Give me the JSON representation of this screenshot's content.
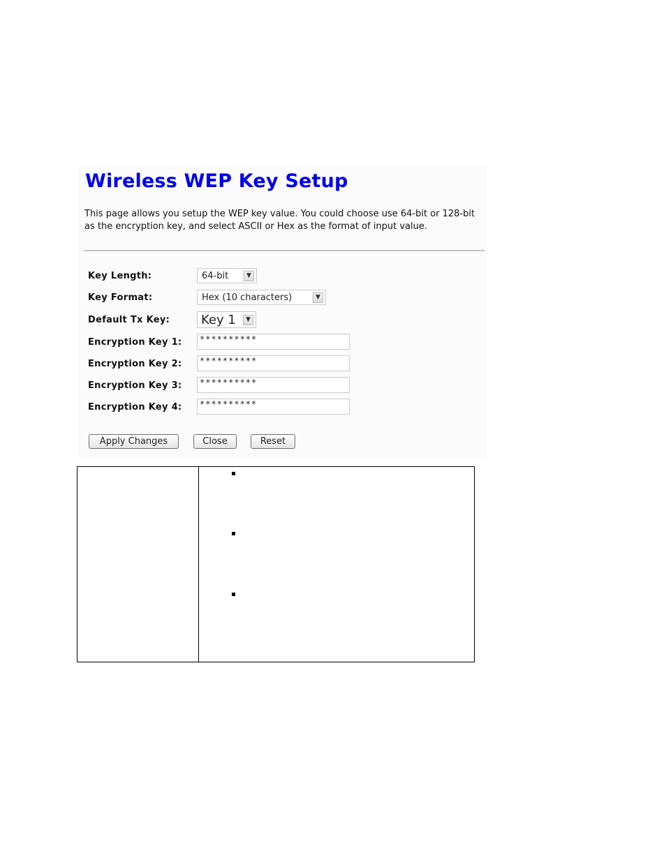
{
  "page": {
    "title": "Wireless WEP Key Setup",
    "description": "This page allows you setup the WEP key value. You could choose use 64-bit or 128-bit as the encryption key, and select ASCII or Hex as the format of input value."
  },
  "form": {
    "key_length": {
      "label": "Key Length:",
      "value": "64-bit"
    },
    "key_format": {
      "label": "Key Format:",
      "value": "Hex (10 characters)"
    },
    "default_tx_key": {
      "label": "Default Tx Key:",
      "value": "Key 1"
    },
    "encryption_keys": [
      {
        "label": "Encryption Key 1:",
        "value": "**********"
      },
      {
        "label": "Encryption Key 2:",
        "value": "**********"
      },
      {
        "label": "Encryption Key 3:",
        "value": "**********"
      },
      {
        "label": "Encryption Key 4:",
        "value": "**********"
      }
    ]
  },
  "buttons": {
    "apply": "Apply Changes",
    "close": "Close",
    "reset": "Reset"
  },
  "icons": {
    "dropdown": "chevron-down-icon",
    "bullet": "square-bullet-icon"
  },
  "colors": {
    "title": "#0000ee"
  }
}
